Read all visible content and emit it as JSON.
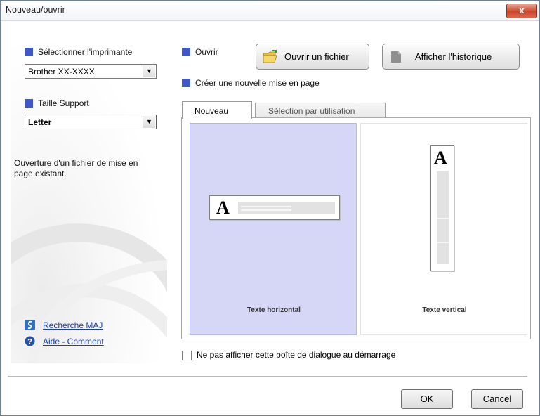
{
  "window": {
    "title": "Nouveau/ouvrir",
    "close_label": "x"
  },
  "left": {
    "printer_label": "Sélectionner l'imprimante",
    "printer_value": "Brother XX-XXXX",
    "media_label": "Taille Support",
    "media_value": "Letter",
    "description": "Ouverture d'un fichier de mise en page existant.",
    "update_link": "Recherche MAJ",
    "help_link": "Aide - Comment"
  },
  "open": {
    "label": "Ouvrir",
    "open_file_button": "Ouvrir un fichier",
    "history_button": "Afficher l'historique"
  },
  "create": {
    "label": "Créer une nouvelle mise en page",
    "tabs": [
      {
        "label": "Nouveau",
        "selected": true
      },
      {
        "label": "Sélection par utilisation",
        "selected": false
      }
    ],
    "layouts": [
      {
        "label": "Texte horizontal",
        "glyph": "A",
        "selected": true
      },
      {
        "label": "Texte vertical",
        "glyph": "A",
        "selected": false
      }
    ]
  },
  "startup_checkbox": {
    "label": "Ne pas afficher cette boîte de dialogue au démarrage",
    "checked": false
  },
  "footer": {
    "ok": "OK",
    "cancel": "Cancel"
  },
  "colors": {
    "accent_square": "#3e58c8",
    "selected_card": "#d6d6f7",
    "link": "#1c3fa8"
  },
  "icons": [
    "close-icon",
    "dropdown-arrow-icon",
    "folder-open-icon",
    "history-icon",
    "update-icon",
    "help-icon"
  ]
}
